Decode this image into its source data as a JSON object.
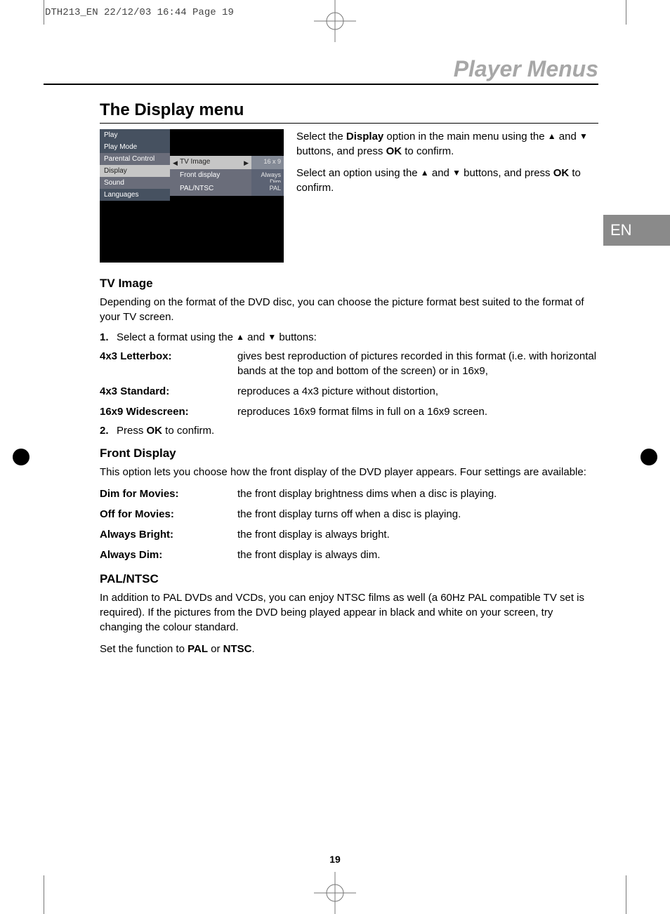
{
  "crop_header": "DTH213_EN  22/12/03  16:44  Page 19",
  "chapter_title": "Player Menus",
  "lang_tab": "EN",
  "page_number": "19",
  "section_title": "The Display menu",
  "menu": {
    "left": [
      "Play",
      "Play Mode",
      "Parental Control",
      "Display",
      "Sound",
      "Languages"
    ],
    "rows": [
      {
        "label": "TV Image",
        "value": "16 x 9",
        "selected": true,
        "arrows": true
      },
      {
        "label": "Front display",
        "value": "Always Dim",
        "selected": false,
        "arrows": false
      },
      {
        "label": "PAL/NTSC",
        "value": "PAL",
        "selected": false,
        "arrows": false
      }
    ]
  },
  "intro": {
    "p1a": "Select the ",
    "p1b": "Display",
    "p1c": " option in the main menu using the ",
    "p1d": " and ",
    "p1e": " buttons, and press ",
    "p1f": "OK",
    "p1g": " to confirm.",
    "p2a": "Select an option using the ",
    "p2b": " and ",
    "p2c": " buttons, and press ",
    "p2d": "OK",
    "p2e": " to confirm."
  },
  "tv_image": {
    "heading": "TV Image",
    "intro": "Depending on the format of the DVD disc, you can choose the picture format best suited to the format of your TV screen.",
    "step1_n": "1.",
    "step1a": "Select a format using the ",
    "step1b": " and ",
    "step1c": " buttons:",
    "defs": [
      {
        "term": "4x3 Letterbox:",
        "desc": "gives best reproduction of pictures recorded in this format (i.e. with horizontal bands at the top and bottom of the screen) or in 16x9,"
      },
      {
        "term": "4x3 Standard:",
        "desc": "reproduces a 4x3 picture without distortion,"
      },
      {
        "term": "16x9 Widescreen:",
        "desc": "reproduces 16x9 format films in full on a 16x9 screen."
      }
    ],
    "step2_n": "2.",
    "step2a": "Press ",
    "step2b": "OK",
    "step2c": " to confirm."
  },
  "front_display": {
    "heading": "Front Display",
    "intro": "This option lets you choose how the front display of the DVD player appears. Four settings are available:",
    "defs": [
      {
        "term": "Dim for Movies:",
        "desc": "the front display brightness dims when a disc is playing."
      },
      {
        "term": "Off for Movies:",
        "desc": "the front display turns off when a disc is playing."
      },
      {
        "term": "Always Bright:",
        "desc": "the front display is always bright."
      },
      {
        "term": "Always Dim:",
        "desc": "the front display is always dim."
      }
    ]
  },
  "pal_ntsc": {
    "heading": "PAL/NTSC",
    "p1": "In addition to PAL DVDs and VCDs, you can enjoy NTSC films as well (a 60Hz PAL compatible TV set is required). If the pictures from the DVD being played appear in black and white on your screen, try changing the colour standard.",
    "p2a": "Set the function to ",
    "p2b": "PAL",
    "p2c": " or ",
    "p2d": "NTSC",
    "p2e": "."
  }
}
